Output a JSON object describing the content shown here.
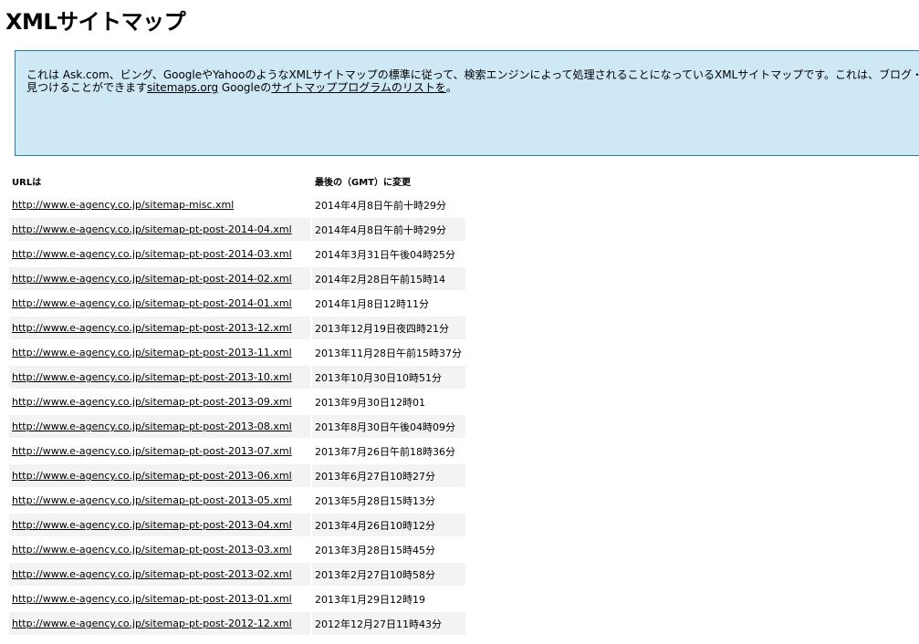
{
  "page": {
    "title": "XMLサイトマップ"
  },
  "intro": {
    "line1": "これは Ask.com、ビング、GoogleやYahooのようなXMLサイトマップの標準に従って、検索エンジンによって処理されることになっているXMLサイトマップです。これは、ブログ・ソフト",
    "line2_prefix": "見つけることができます",
    "sitemaps_link": "sitemaps.org",
    "line2_mid": " Googleの",
    "google_link": "サイトマッププログラムのリストを",
    "line2_suffix": "。"
  },
  "table": {
    "headers": {
      "url": "URLは",
      "lastmod": "最後の（GMT）に変更"
    },
    "rows": [
      {
        "url": "http://www.e-agency.co.jp/sitemap-misc.xml",
        "lastmod": "2014年4月8日午前十時29分"
      },
      {
        "url": "http://www.e-agency.co.jp/sitemap-pt-post-2014-04.xml",
        "lastmod": "2014年4月8日午前十時29分"
      },
      {
        "url": "http://www.e-agency.co.jp/sitemap-pt-post-2014-03.xml",
        "lastmod": "2014年3月31日午後04時25分"
      },
      {
        "url": "http://www.e-agency.co.jp/sitemap-pt-post-2014-02.xml",
        "lastmod": "2014年2月28日午前15時14"
      },
      {
        "url": "http://www.e-agency.co.jp/sitemap-pt-post-2014-01.xml",
        "lastmod": "2014年1月8日12時11分"
      },
      {
        "url": "http://www.e-agency.co.jp/sitemap-pt-post-2013-12.xml",
        "lastmod": "2013年12月19日夜四時21分"
      },
      {
        "url": "http://www.e-agency.co.jp/sitemap-pt-post-2013-11.xml",
        "lastmod": "2013年11月28日午前15時37分"
      },
      {
        "url": "http://www.e-agency.co.jp/sitemap-pt-post-2013-10.xml",
        "lastmod": "2013年10月30日10時51分"
      },
      {
        "url": "http://www.e-agency.co.jp/sitemap-pt-post-2013-09.xml",
        "lastmod": "2013年9月30日12時01"
      },
      {
        "url": "http://www.e-agency.co.jp/sitemap-pt-post-2013-08.xml",
        "lastmod": "2013年8月30日午後04時09分"
      },
      {
        "url": "http://www.e-agency.co.jp/sitemap-pt-post-2013-07.xml",
        "lastmod": "2013年7月26日午前18時36分"
      },
      {
        "url": "http://www.e-agency.co.jp/sitemap-pt-post-2013-06.xml",
        "lastmod": "2013年6月27日10時27分"
      },
      {
        "url": "http://www.e-agency.co.jp/sitemap-pt-post-2013-05.xml",
        "lastmod": "2013年5月28日15時13分"
      },
      {
        "url": "http://www.e-agency.co.jp/sitemap-pt-post-2013-04.xml",
        "lastmod": "2013年4月26日10時12分"
      },
      {
        "url": "http://www.e-agency.co.jp/sitemap-pt-post-2013-03.xml",
        "lastmod": "2013年3月28日15時45分"
      },
      {
        "url": "http://www.e-agency.co.jp/sitemap-pt-post-2013-02.xml",
        "lastmod": "2013年2月27日10時58分"
      },
      {
        "url": "http://www.e-agency.co.jp/sitemap-pt-post-2013-01.xml",
        "lastmod": "2013年1月29日12時19"
      },
      {
        "url": "http://www.e-agency.co.jp/sitemap-pt-post-2012-12.xml",
        "lastmod": "2012年12月27日11時43分"
      }
    ]
  }
}
